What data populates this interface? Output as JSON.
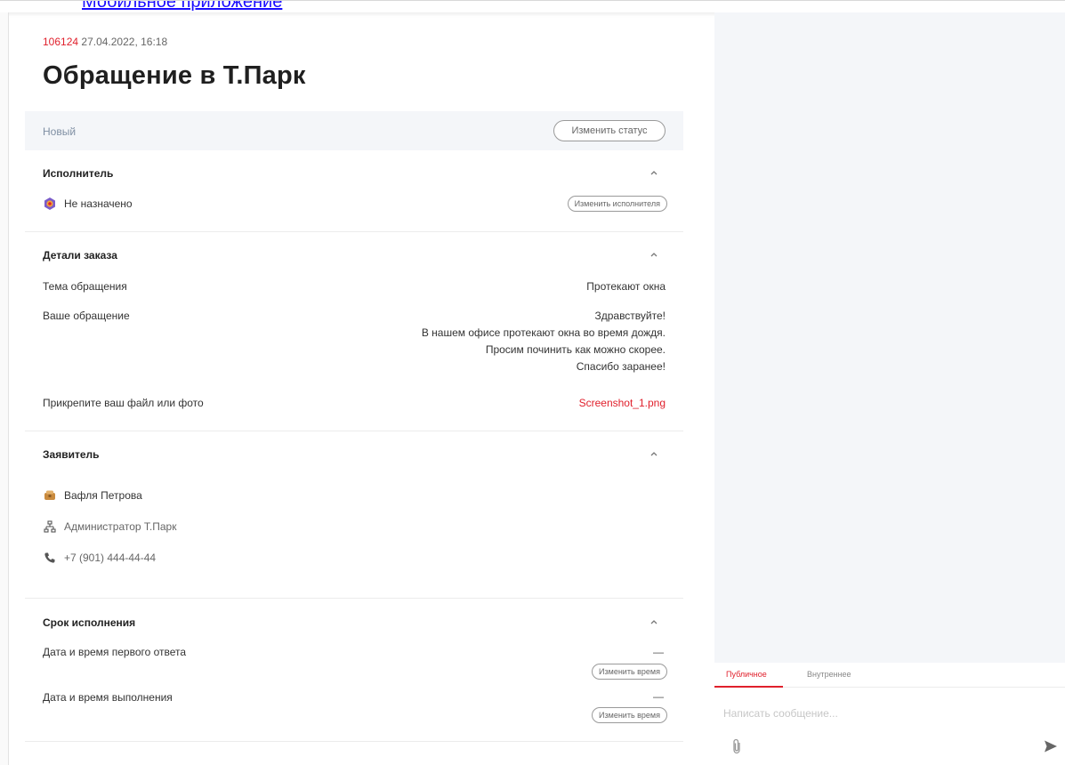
{
  "top_link": "Мобильное приложение",
  "ticket": {
    "id": "106124",
    "datetime": "27.04.2022, 16:18",
    "title": "Обращение в Т.Парк",
    "status": "Новый",
    "change_status_label": "Изменить статус"
  },
  "assignee": {
    "title": "Исполнитель",
    "value": "Не назначено",
    "change_label": "Изменить исполнителя"
  },
  "order_details": {
    "title": "Детали заказа",
    "topic_label": "Тема обращения",
    "topic_value": "Протекают окна",
    "request_label": "Ваше обращение",
    "request_lines": [
      "Здравствуйте!",
      "В нашем офисе протекают окна во время дождя.",
      "Просим починить как можно скорее.",
      "Спасибо заранее!"
    ],
    "file_label": "Прикрепите ваш файл или фото",
    "file_value": "Screenshot_1.png"
  },
  "applicant": {
    "title": "Заявитель",
    "name": "Вафля Петрова",
    "role": "Администратор Т.Парк",
    "phone": "+7 (901) 444-44-44"
  },
  "deadline": {
    "title": "Срок исполнения",
    "first_response_label": "Дата и время первого ответа",
    "first_response_value": "—",
    "completion_label": "Дата и время выполнения",
    "completion_value": "—",
    "change_time_label": "Изменить время"
  },
  "chat": {
    "tab_public": "Публичное",
    "tab_internal": "Внутреннее",
    "placeholder": "Написать сообщение..."
  },
  "colors": {
    "accent": "#e0202c",
    "status_bar": "#f4f6f9",
    "status_text": "#7f8fa3"
  },
  "icons": [
    "chevron-up-icon",
    "assignee-avatar-icon",
    "applicant-avatar-icon",
    "org-structure-icon",
    "phone-icon",
    "paperclip-icon",
    "send-icon"
  ]
}
